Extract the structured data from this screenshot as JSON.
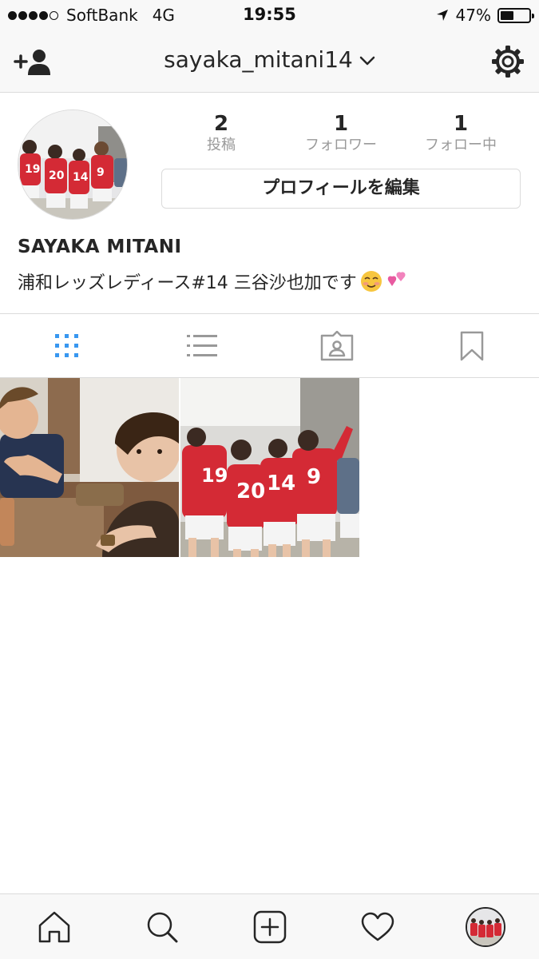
{
  "status_bar": {
    "carrier": "SoftBank",
    "network": "4G",
    "time": "19:55",
    "battery": "47%",
    "battery_level": 0.47
  },
  "nav": {
    "username": "sayaka_mitani14"
  },
  "profile": {
    "posts_count": "2",
    "posts_label": "投稿",
    "followers_count": "1",
    "followers_label": "フォロワー",
    "following_count": "1",
    "following_label": "フォロー中",
    "edit_button": "プロフィールを編集",
    "display_name": "SAYAKA MITANI",
    "bio": "浦和レッズレディース#14 三谷沙也加です"
  },
  "tabs": [
    {
      "icon": "grid-icon",
      "active": true
    },
    {
      "icon": "list-icon",
      "active": false
    },
    {
      "icon": "tagged-photos-icon",
      "active": false
    },
    {
      "icon": "bookmark-icon",
      "active": false
    }
  ],
  "posts": [
    {
      "description_icon": "photo-selfie"
    },
    {
      "description_icon": "photo-team"
    }
  ],
  "bottom_nav": [
    "home-icon",
    "search-icon",
    "new-post-icon",
    "activity-heart-icon",
    "profile-avatar"
  ],
  "colors": {
    "active_tab": "#3897f0",
    "inactive_icon": "#999999",
    "jersey_red": "#d42a35"
  }
}
